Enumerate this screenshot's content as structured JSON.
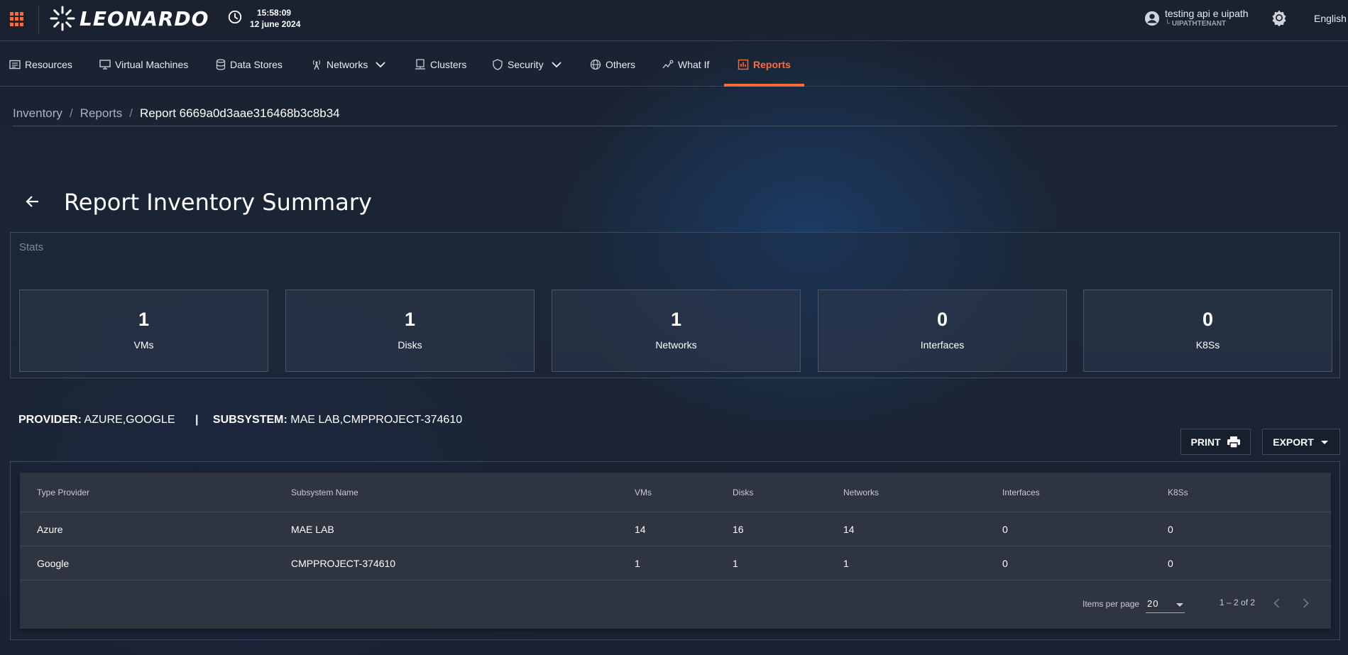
{
  "header": {
    "brand": "LEONARDO",
    "time": "15:58:09",
    "date": "12 june 2024",
    "user_name": "testing api e uipath",
    "user_tenant": "└ UIPATHTENANT",
    "language": "English"
  },
  "nav": {
    "items": [
      {
        "label": "Resources",
        "icon": "resources-icon"
      },
      {
        "label": "Virtual Machines",
        "icon": "monitor-icon"
      },
      {
        "label": "Data Stores",
        "icon": "database-icon"
      },
      {
        "label": "Networks",
        "icon": "antenna-icon"
      },
      {
        "label": "Clusters",
        "icon": "clusters-icon"
      },
      {
        "label": "Security",
        "icon": "shield-icon"
      },
      {
        "label": "Others",
        "icon": "globe-icon"
      },
      {
        "label": "What If",
        "icon": "trend-icon"
      },
      {
        "label": "Reports",
        "icon": "report-icon"
      }
    ],
    "active": "Reports",
    "accent_color": "#ff6a3d"
  },
  "breadcrumb": {
    "items": [
      "Inventory",
      "Reports"
    ],
    "current": "Report 6669a0d3aae316468b3c8b34"
  },
  "page": {
    "title": "Report Inventory Summary"
  },
  "stats": {
    "label": "Stats",
    "cards": [
      {
        "value": "1",
        "label": "VMs"
      },
      {
        "value": "1",
        "label": "Disks"
      },
      {
        "value": "1",
        "label": "Networks"
      },
      {
        "value": "0",
        "label": "Interfaces"
      },
      {
        "value": "0",
        "label": "K8Ss"
      }
    ]
  },
  "filters": {
    "provider_label": "PROVIDER:",
    "provider_value": "AZURE,GOOGLE",
    "separator": "|",
    "subsystem_label": "SUBSYSTEM:",
    "subsystem_value": "MAE LAB,CMPPROJECT-374610"
  },
  "actions": {
    "print": "PRINT",
    "export": "EXPORT"
  },
  "table": {
    "columns": [
      "Type Provider",
      "Subsystem Name",
      "VMs",
      "Disks",
      "Networks",
      "Interfaces",
      "K8Ss"
    ],
    "rows": [
      [
        "Azure",
        "MAE LAB",
        "14",
        "16",
        "14",
        "0",
        "0"
      ],
      [
        "Google",
        "CMPPROJECT-374610",
        "1",
        "1",
        "1",
        "0",
        "0"
      ]
    ]
  },
  "paginator": {
    "items_per_page_label": "Items per page",
    "items_per_page": "20",
    "range": "1 – 2 of 2"
  }
}
